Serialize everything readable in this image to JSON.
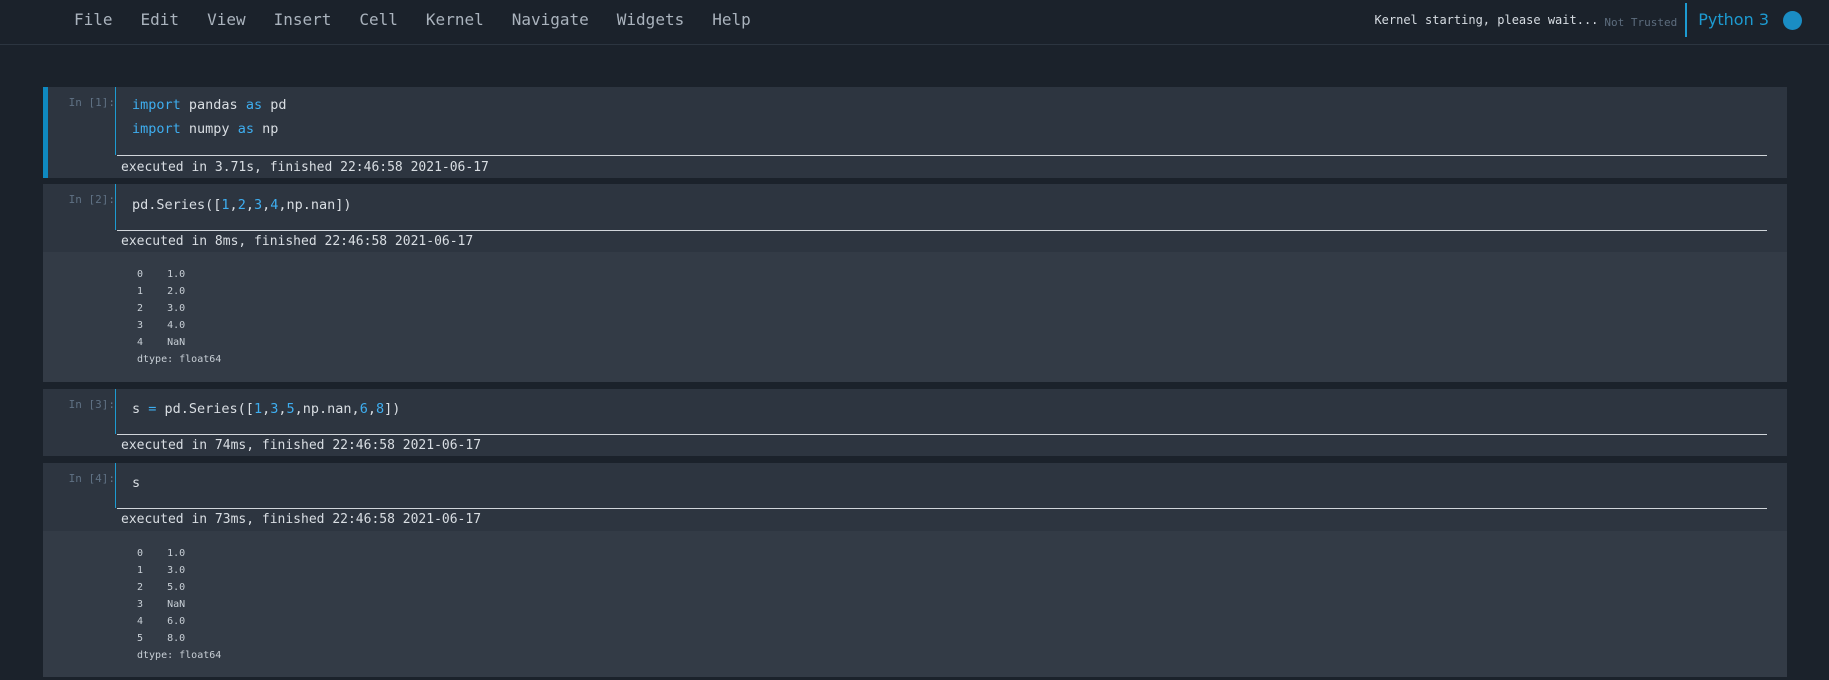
{
  "menubar": {
    "items": [
      "File",
      "Edit",
      "View",
      "Insert",
      "Cell",
      "Kernel",
      "Navigate",
      "Widgets",
      "Help"
    ],
    "kernel_status": "Kernel starting, please wait...",
    "trust_status": "Not Trusted",
    "kernel_name": "Python 3"
  },
  "colors": {
    "accent": "#1d9bd1",
    "background": "#1b222b",
    "cell_background": "#2d3540"
  },
  "cells": [
    {
      "prompt": "In [1]:",
      "code": [
        "import pandas as pd",
        "import numpy as np"
      ],
      "exec": "executed in 3.71s, finished 22:46:58 2021-06-17"
    },
    {
      "prompt": "In [2]:",
      "code": [
        "pd.Series([1,2,3,4,np.nan])"
      ],
      "exec": "executed in 8ms, finished 22:46:58 2021-06-17",
      "output": [
        "0    1.0",
        "1    2.0",
        "2    3.0",
        "3    4.0",
        "4    NaN",
        "dtype: float64"
      ]
    },
    {
      "prompt": "In [3]:",
      "code": [
        "s = pd.Series([1,3,5,np.nan,6,8])"
      ],
      "exec": "executed in 74ms, finished 22:46:58 2021-06-17"
    },
    {
      "prompt": "In [4]:",
      "code": [
        "s"
      ],
      "exec": "executed in 73ms, finished 22:46:58 2021-06-17",
      "output": [
        "0    1.0",
        "1    3.0",
        "2    5.0",
        "3    NaN",
        "4    6.0",
        "5    8.0",
        "dtype: float64"
      ]
    }
  ]
}
